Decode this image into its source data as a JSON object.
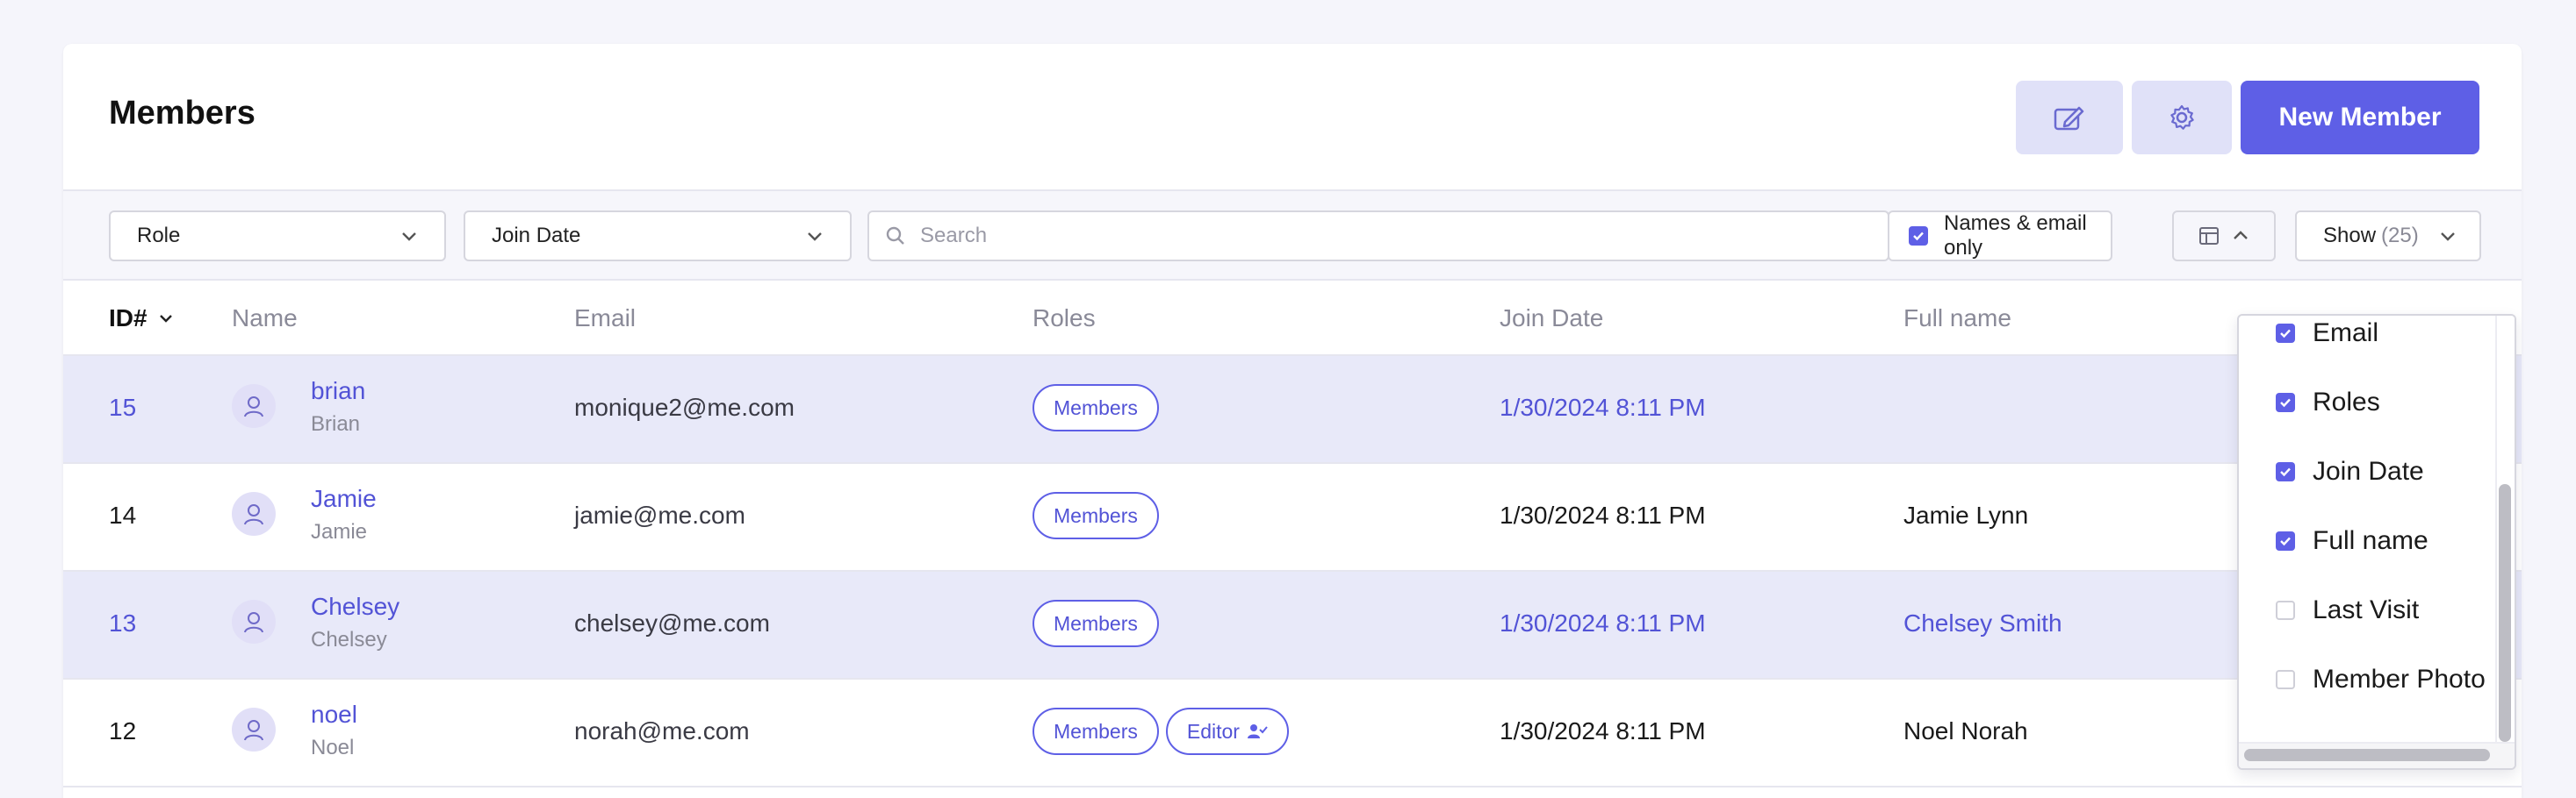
{
  "header": {
    "title": "Members",
    "new_button": "New Member"
  },
  "filters": {
    "role": "Role",
    "join_date": "Join Date",
    "search_placeholder": "Search",
    "names_only_label": "Names & email only",
    "names_only_checked": true,
    "show_label": "Show",
    "show_count": "(25)"
  },
  "table": {
    "columns": [
      "ID#",
      "Name",
      "Email",
      "Roles",
      "Join Date",
      "Full name"
    ],
    "rows": [
      {
        "id": "15",
        "username": "brian",
        "name": "Brian",
        "email": "monique2@me.com",
        "roles": [
          "Members"
        ],
        "join_date": "1/30/2024 8:11 PM",
        "full_name": "",
        "highlighted": true
      },
      {
        "id": "14",
        "username": "Jamie",
        "name": "Jamie",
        "email": "jamie@me.com",
        "roles": [
          "Members"
        ],
        "join_date": "1/30/2024 8:11 PM",
        "full_name": "Jamie Lynn",
        "highlighted": false
      },
      {
        "id": "13",
        "username": "Chelsey",
        "name": "Chelsey",
        "email": "chelsey@me.com",
        "roles": [
          "Members"
        ],
        "join_date": "1/30/2024 8:11 PM",
        "full_name": "Chelsey Smith",
        "highlighted": true
      },
      {
        "id": "12",
        "username": "noel",
        "name": "Noel",
        "email": "norah@me.com",
        "roles": [
          "Members",
          "Editor"
        ],
        "join_date": "1/30/2024 8:11 PM",
        "full_name": "Noel Norah",
        "highlighted": false
      }
    ]
  },
  "column_menu": {
    "items": [
      {
        "label": "Email",
        "checked": true
      },
      {
        "label": "Roles",
        "checked": true
      },
      {
        "label": "Join Date",
        "checked": true
      },
      {
        "label": "Full name",
        "checked": true
      },
      {
        "label": "Last Visit",
        "checked": false
      },
      {
        "label": "Member Photo",
        "checked": false
      }
    ]
  },
  "icons": {
    "edit": "edit-icon",
    "gear": "gear-icon",
    "search": "search-icon",
    "columns": "columns-icon",
    "chevron": "chevron-down-icon",
    "avatar": "user-icon",
    "editor_badge": "user-check-icon"
  },
  "colors": {
    "accent": "#5e5fe6",
    "accent_text": "#5253d6",
    "row_highlight": "#e8e9f9",
    "button_soft": "#e0e1f8"
  }
}
